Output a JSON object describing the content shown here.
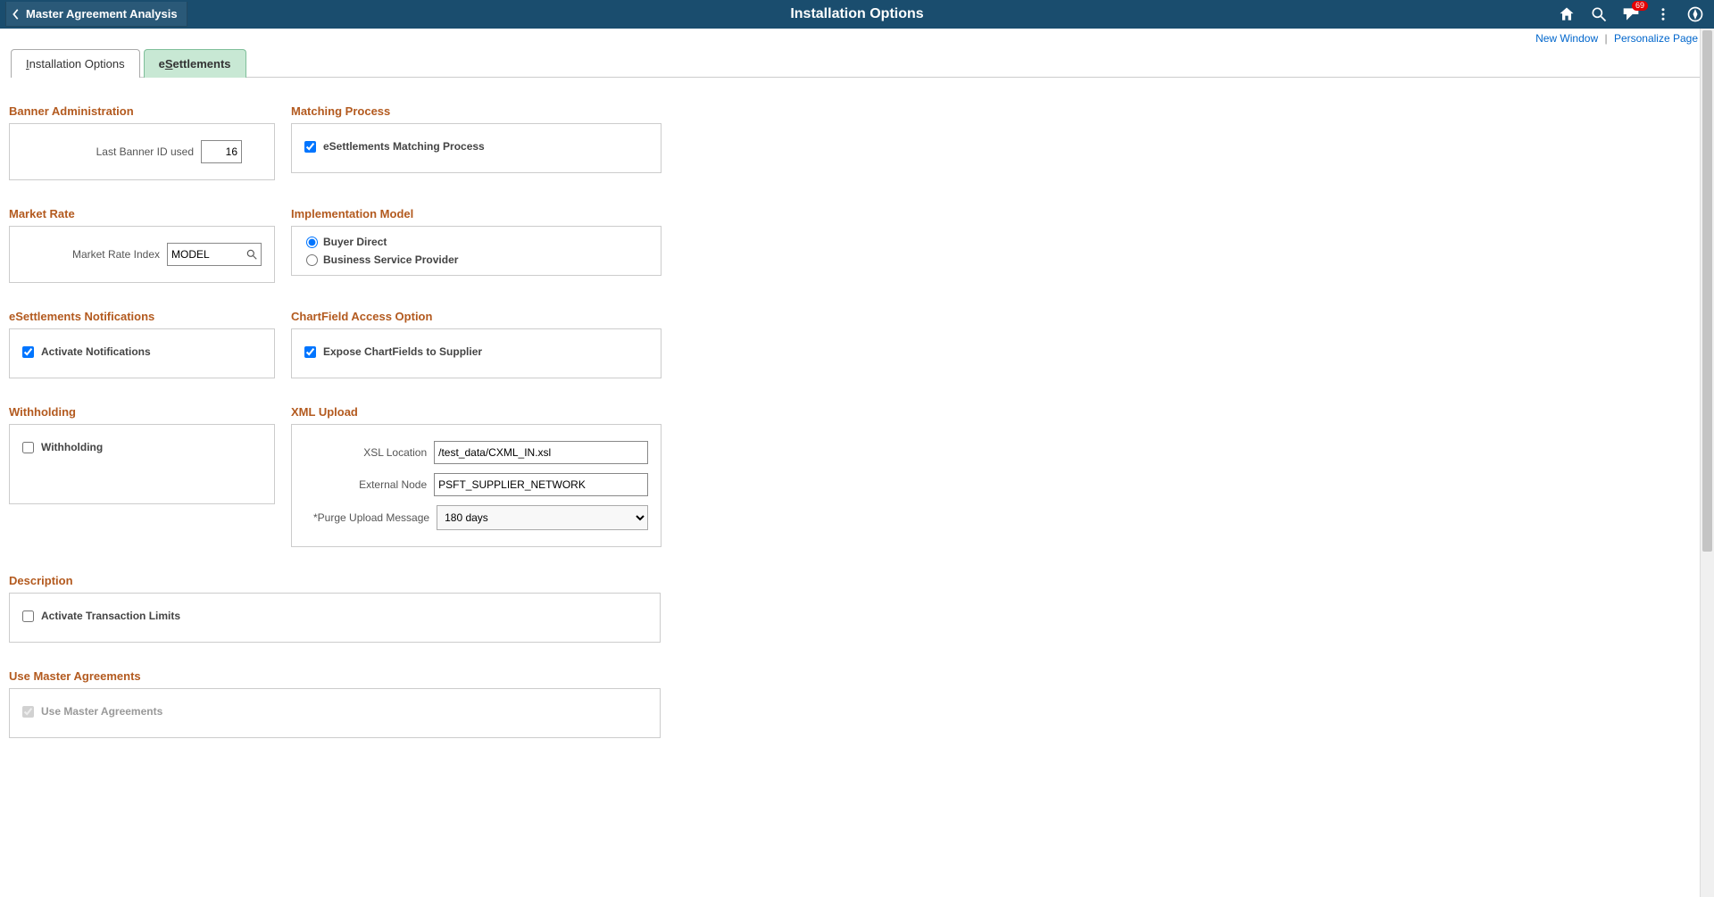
{
  "header": {
    "breadcrumb": "Master Agreement Analysis",
    "title": "Installation Options",
    "notification_count": "69"
  },
  "sub_links": {
    "new_window": "New Window",
    "personalize": "Personalize Page"
  },
  "tabs": {
    "installation_prefix": "I",
    "installation_rest": "nstallation Options",
    "esettlements_prefix": "e",
    "esettlements_mid": "S",
    "esettlements_rest": "ettlements"
  },
  "sections": {
    "banner_admin": {
      "title": "Banner Administration",
      "label_last_banner": "Last Banner ID used",
      "value_last_banner": "16"
    },
    "matching": {
      "title": "Matching Process",
      "check_label": "eSettlements Matching Process"
    },
    "market_rate": {
      "title": "Market Rate",
      "label_index": "Market Rate Index",
      "value_index": "MODEL"
    },
    "impl_model": {
      "title": "Implementation Model",
      "opt_buyer": "Buyer Direct",
      "opt_bsp": "Business Service Provider"
    },
    "notifications": {
      "title": "eSettlements Notifications",
      "check_label": "Activate Notifications"
    },
    "cf_access": {
      "title": "ChartField Access Option",
      "check_label": "Expose ChartFields to Supplier"
    },
    "withholding": {
      "title": "Withholding",
      "check_label": "Withholding"
    },
    "xml_upload": {
      "title": "XML Upload",
      "label_xsl": "XSL Location",
      "value_xsl": "/test_data/CXML_IN.xsl",
      "label_ext": "External Node",
      "value_ext": "PSFT_SUPPLIER_NETWORK",
      "label_purge": "Purge Upload Message",
      "value_purge": "180 days"
    },
    "description": {
      "title": "Description",
      "check_label": "Activate Transaction Limits"
    },
    "master_agr": {
      "title": "Use Master Agreements",
      "check_label": "Use Master Agreements"
    }
  }
}
